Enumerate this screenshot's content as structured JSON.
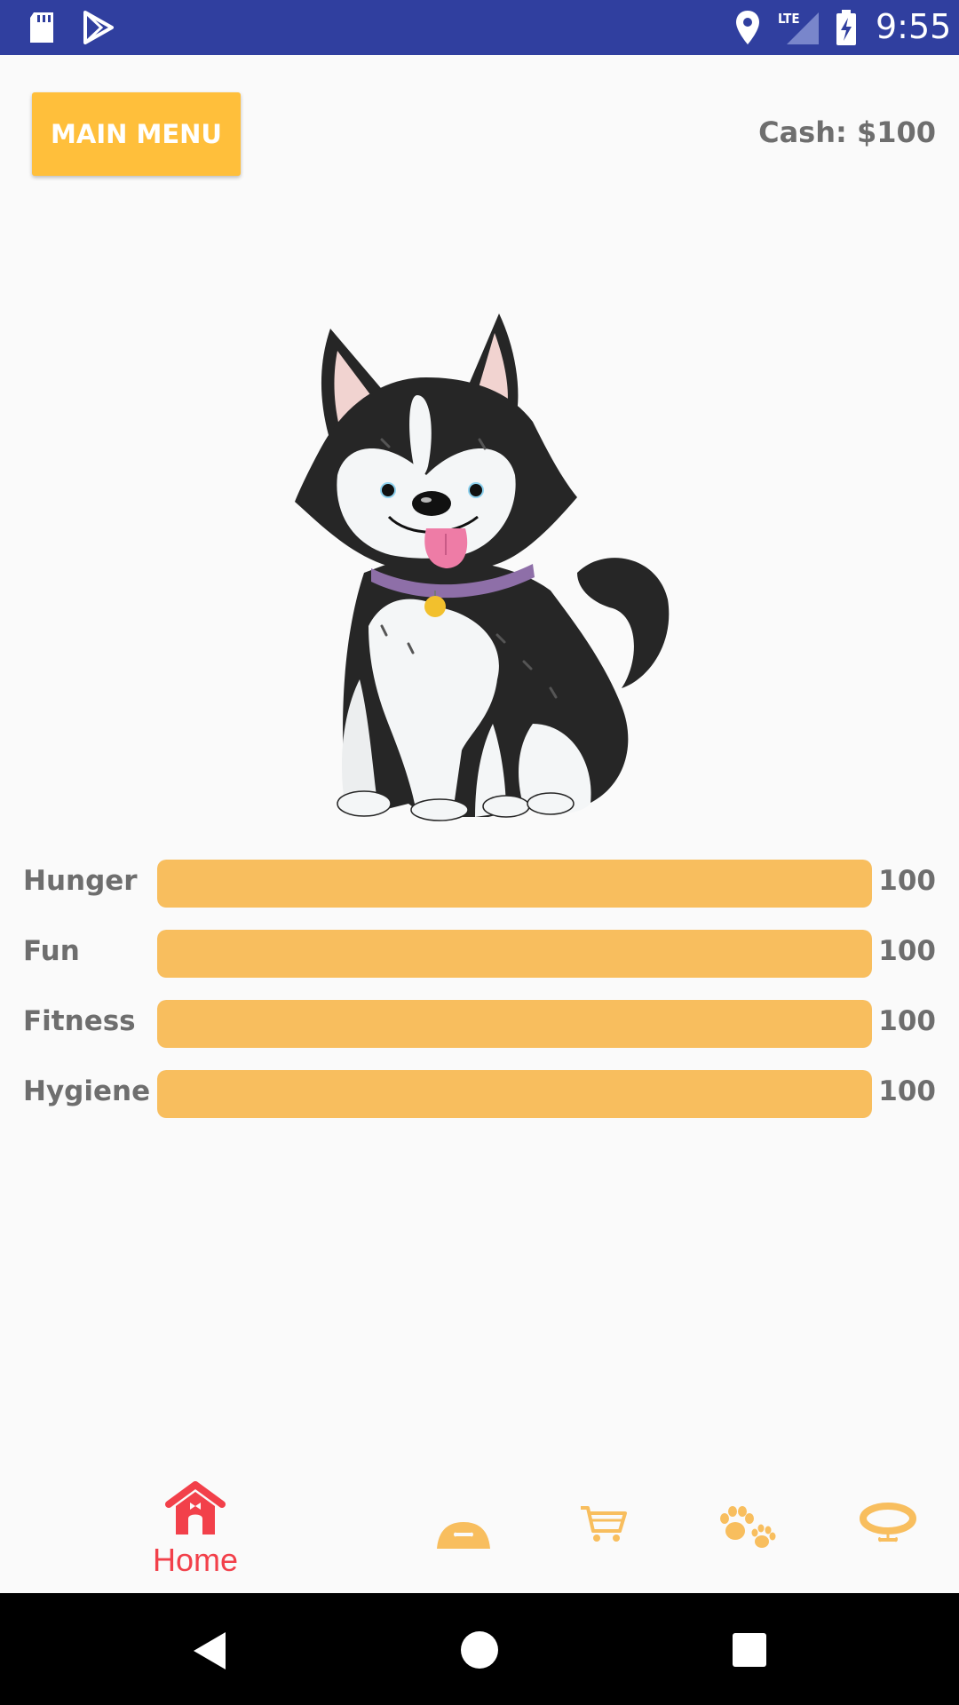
{
  "status_bar": {
    "time": "9:55",
    "network_label": "LTE",
    "icons": [
      "sd-card-icon",
      "play-store-icon",
      "location-icon",
      "lte-signal-icon",
      "battery-charging-icon"
    ],
    "background_color": "#303f9f"
  },
  "header": {
    "main_menu_label": "MAIN MENU",
    "cash_label": "Cash: $100",
    "button_color": "#ffbf3b"
  },
  "pet": {
    "image": "husky-puppy-illustration"
  },
  "stats": [
    {
      "label": "Hunger",
      "value": "100",
      "level": 1.0
    },
    {
      "label": "Fun",
      "value": "100",
      "level": 1.0
    },
    {
      "label": "Fitness",
      "value": "100",
      "level": 1.0
    },
    {
      "label": "Hygiene",
      "value": "100",
      "level": 1.0
    }
  ],
  "stat_bar_color": "#f8be5e",
  "bottom_nav": {
    "active_color": "#f2404a",
    "inactive_color": "#f8be5e",
    "items": [
      {
        "label": "Home",
        "icon": "dog-house-icon",
        "active": true
      },
      {
        "label": "",
        "icon": "food-bowl-icon",
        "active": false
      },
      {
        "label": "",
        "icon": "shopping-cart-icon",
        "active": false
      },
      {
        "label": "",
        "icon": "paw-prints-icon",
        "active": false
      },
      {
        "label": "",
        "icon": "collar-icon",
        "active": false
      }
    ]
  },
  "system_nav": {
    "icons": [
      "back-icon",
      "home-circle-icon",
      "recents-icon"
    ]
  }
}
